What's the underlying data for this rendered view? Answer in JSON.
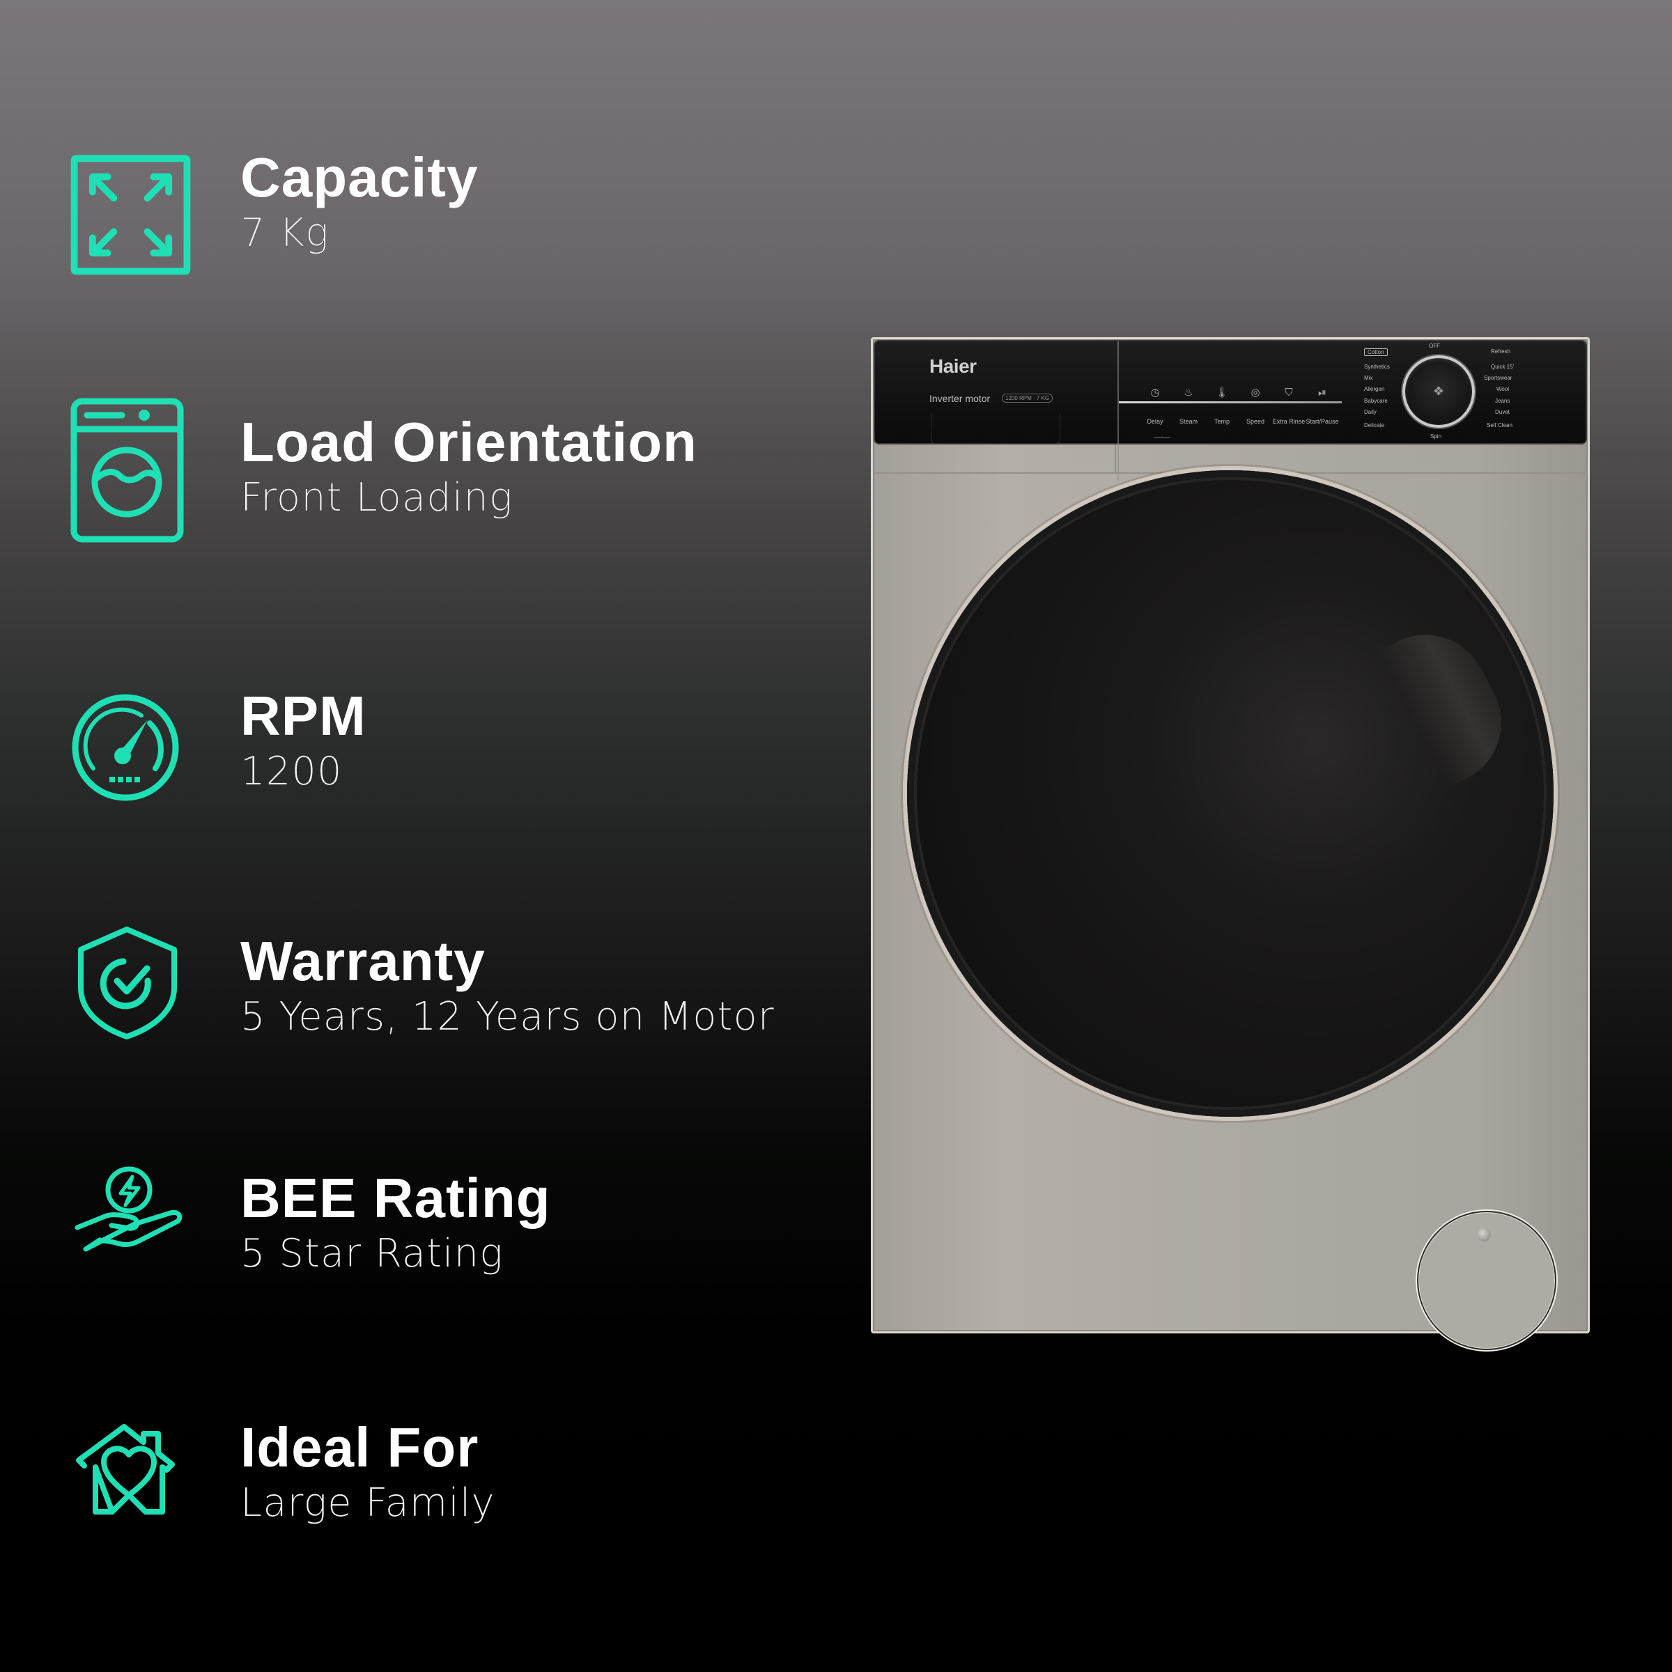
{
  "accent_color": "#1fe0b4",
  "specs": [
    {
      "icon": "expand-arrows-icon",
      "title": "Capacity",
      "value": "7 Kg"
    },
    {
      "icon": "washing-machine-icon",
      "title": "Load Orientation",
      "value": "Front Loading"
    },
    {
      "icon": "speedometer-icon",
      "title": "RPM",
      "value": "1200"
    },
    {
      "icon": "shield-check-icon",
      "title": "Warranty",
      "value": "5 Years, 12 Years on Motor"
    },
    {
      "icon": "hand-energy-icon",
      "title": "BEE Rating",
      "value": "5 Star Rating"
    },
    {
      "icon": "home-heart-icon",
      "title": "Ideal For",
      "value": "Large Family"
    }
  ],
  "product": {
    "brand": "Haier",
    "motor_label": "Inverter motor",
    "badge_text": "1200 RPM · 7 KG",
    "buttons": [
      "Delay",
      "Steam",
      "Temp",
      "Speed",
      "Extra Rinse",
      "Start/Pause"
    ],
    "dial": {
      "top": "OFF",
      "bottom": "Spin",
      "left_programs": [
        "Cotton",
        "Synthetics",
        "Mix",
        "Allergen",
        "Babycare",
        "Daily",
        "Delicate"
      ],
      "right_programs": [
        "Refresh",
        "Quick 15'",
        "Sportswear",
        "Wool",
        "Jeans",
        "Duvet",
        "Self Clean"
      ],
      "selected": "Cotton"
    }
  }
}
